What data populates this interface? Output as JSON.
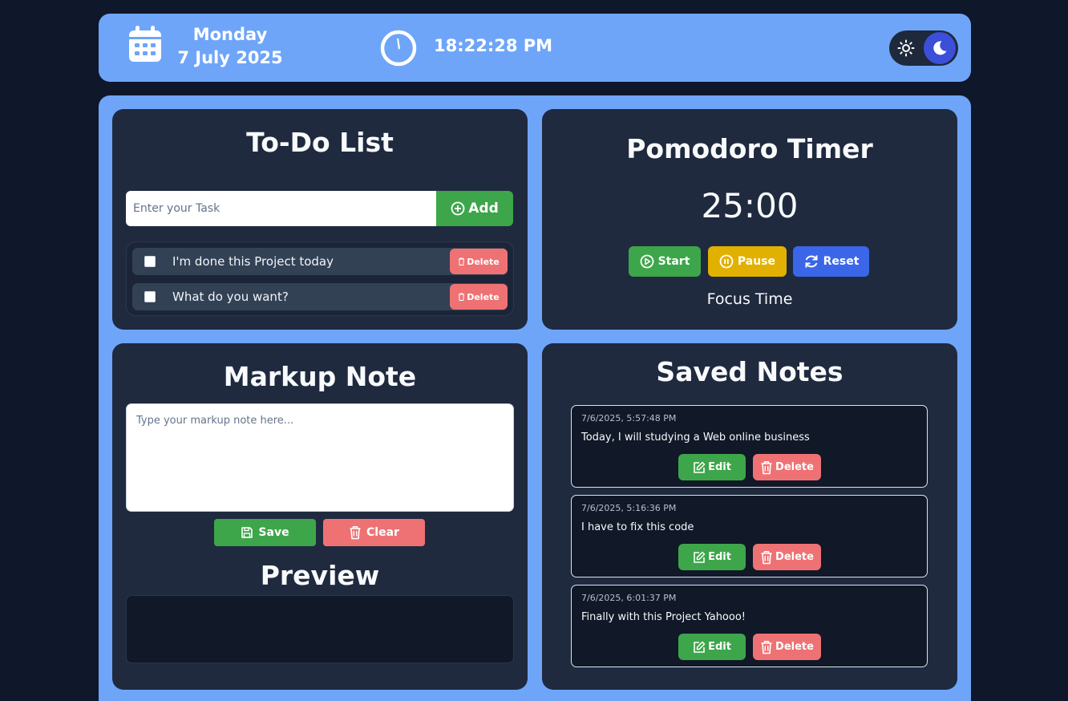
{
  "header": {
    "day": "Monday",
    "date": "7 July 2025",
    "time": "18:22:28 PM",
    "icons": {
      "calendar": "calendar-icon",
      "clock": "clock-icon",
      "sun": "sun-icon",
      "moon": "moon-icon"
    },
    "theme": "dark"
  },
  "todo": {
    "title": "To-Do List",
    "input_placeholder": "Enter your Task",
    "add_label": "Add",
    "tasks": [
      {
        "text": "I'm done this Project today",
        "checked": false,
        "delete_label": "Delete"
      },
      {
        "text": "What do you want?",
        "checked": false,
        "delete_label": "Delete"
      }
    ]
  },
  "pomodoro": {
    "title": "Pomodoro Timer",
    "time": "25:00",
    "start_label": "Start",
    "pause_label": "Pause",
    "reset_label": "Reset",
    "mode_label": "Focus Time"
  },
  "markup": {
    "title": "Markup Note",
    "textarea_placeholder": "Type your markup note here...",
    "save_label": "Save",
    "clear_label": "Clear",
    "preview_title": "Preview"
  },
  "saved": {
    "title": "Saved Notes",
    "notes": [
      {
        "date": "7/6/2025, 5:57:48 PM",
        "text": "Today, I will studying a Web online business",
        "edit_label": "Edit",
        "delete_label": "Delete"
      },
      {
        "date": "7/6/2025, 5:16:36 PM",
        "text": "I have to fix this code",
        "edit_label": "Edit",
        "delete_label": "Delete"
      },
      {
        "date": "7/6/2025, 6:01:37 PM",
        "text": "Finally with this Project Yahooo!",
        "edit_label": "Edit",
        "delete_label": "Delete"
      }
    ]
  },
  "colors": {
    "background": "#0f172a",
    "accent": "#6ea5f8",
    "card": "#1f2a3f",
    "green": "#3da64a",
    "red": "#ee7274",
    "yellow": "#e2b000",
    "blue": "#3b66e8"
  }
}
